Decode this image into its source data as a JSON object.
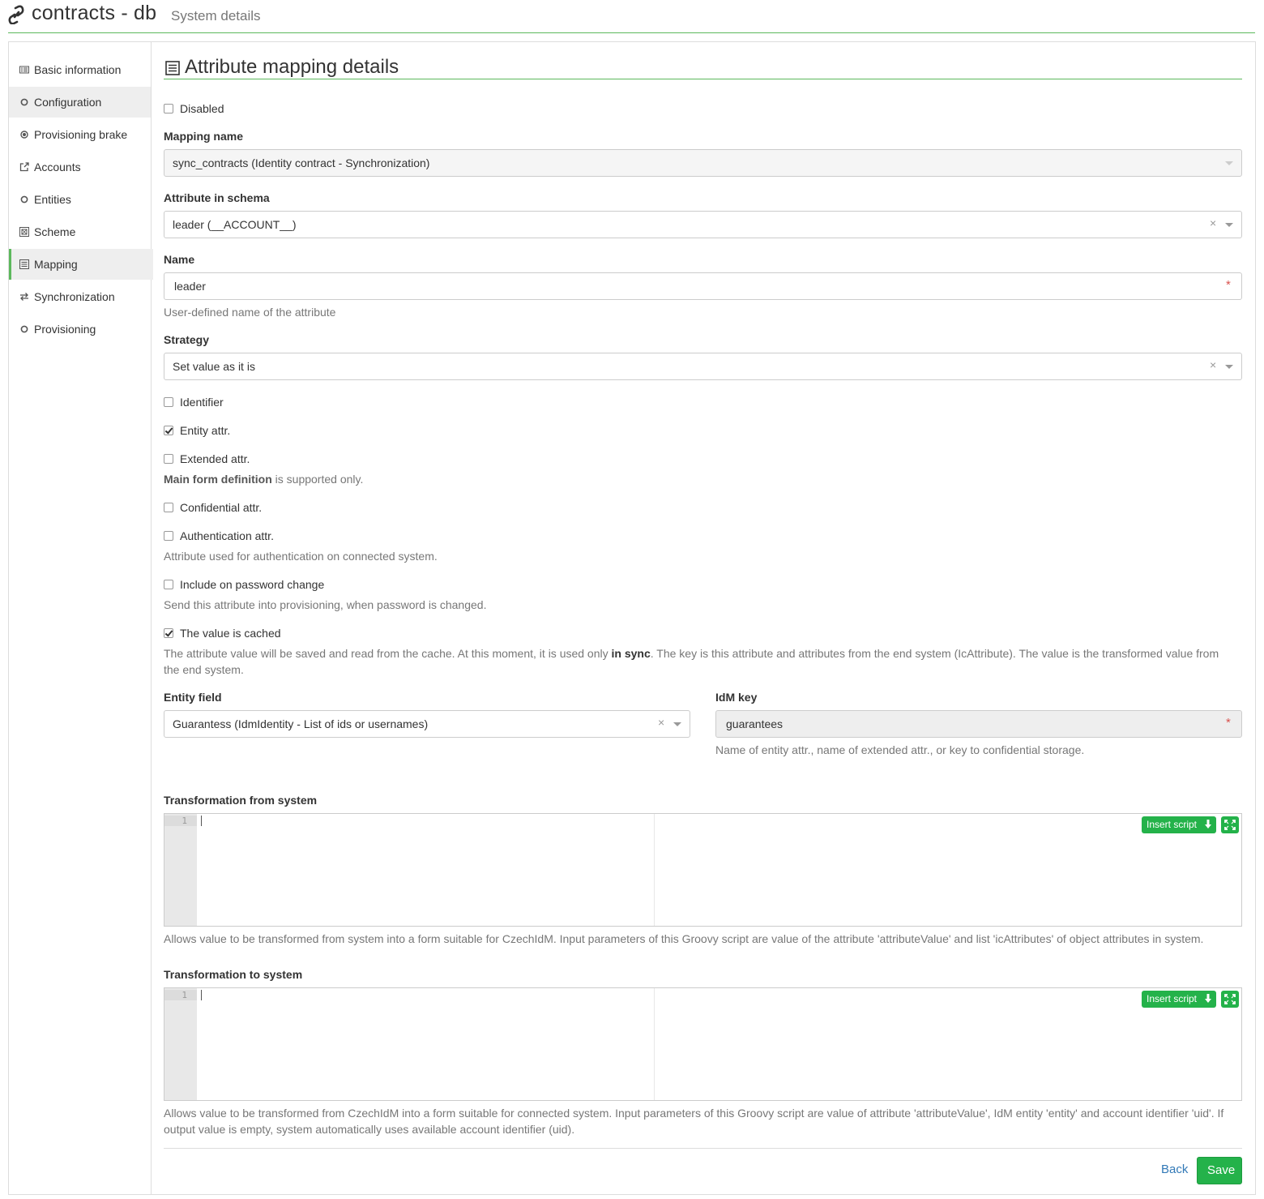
{
  "header": {
    "title": "contracts - db",
    "subtitle": "System details"
  },
  "sidebar": {
    "items": [
      {
        "label": "Basic information",
        "icon": "list-alt-icon"
      },
      {
        "label": "Configuration",
        "icon": "circle-icon"
      },
      {
        "label": "Provisioning brake",
        "icon": "record-icon"
      },
      {
        "label": "Accounts",
        "icon": "external-link-icon"
      },
      {
        "label": "Entities",
        "icon": "circle-icon"
      },
      {
        "label": "Scheme",
        "icon": "object-align-icon"
      },
      {
        "label": "Mapping",
        "icon": "list-icon",
        "active": true
      },
      {
        "label": "Synchronization",
        "icon": "transfer-icon"
      },
      {
        "label": "Provisioning",
        "icon": "circle-icon"
      }
    ]
  },
  "main": {
    "title": "Attribute mapping details",
    "disabled": {
      "label": "Disabled",
      "checked": false
    },
    "mapping_name": {
      "label": "Mapping name",
      "value": "sync_contracts (Identity contract - Synchronization)"
    },
    "attribute_in_schema": {
      "label": "Attribute in schema",
      "value": "leader (__ACCOUNT__)"
    },
    "name": {
      "label": "Name",
      "value": "leader",
      "help": "User-defined name of the attribute"
    },
    "strategy": {
      "label": "Strategy",
      "value": "Set value as it is"
    },
    "identifier": {
      "label": "Identifier",
      "checked": false
    },
    "entity_attr": {
      "label": "Entity attr.",
      "checked": true
    },
    "extended_attr": {
      "label": "Extended attr.",
      "checked": false,
      "help_bold": "Main form definition",
      "help_rest": " is supported only."
    },
    "confidential_attr": {
      "label": "Confidential attr.",
      "checked": false
    },
    "authentication_attr": {
      "label": "Authentication attr.",
      "checked": false,
      "help": "Attribute used for authentication on connected system."
    },
    "password_change": {
      "label": "Include on password change",
      "checked": false,
      "help": "Send this attribute into provisioning, when password is changed."
    },
    "cached": {
      "label": "The value is cached",
      "checked": true,
      "help_part1": "The attribute value will be saved and read from the cache. At this moment, it is used only ",
      "help_bold": "in sync",
      "help_part2": ". The key is this attribute and attributes from the end system (IcAttribute). The value is the transformed value from the end system."
    },
    "entity_field": {
      "label": "Entity field",
      "value": "Guarantess (IdmIdentity - List of ids or usernames)"
    },
    "idm_key": {
      "label": "IdM key",
      "value": "guarantees",
      "help": "Name of entity attr., name of extended attr., or key to confidential storage."
    },
    "transform_from": {
      "label": "Transformation from system",
      "line_number": "1",
      "insert_label": "Insert script",
      "help": "Allows value to be transformed from system into a form suitable for CzechIdM. Input parameters of this Groovy script are value of the attribute 'attributeValue' and list 'icAttributes' of object attributes in system."
    },
    "transform_to": {
      "label": "Transformation to system",
      "line_number": "1",
      "insert_label": "Insert script",
      "help": "Allows value to be transformed from CzechIdM into a form suitable for connected system. Input parameters of this Groovy script are value of attribute 'attributeValue', IdM entity 'entity' and account identifier 'uid'. If output value is empty, system automatically uses available account identifier (uid)."
    }
  },
  "footer": {
    "back_label": "Back",
    "save_label": "Save"
  },
  "colors": {
    "accent": "#5cb85c",
    "button_green": "#24b24a",
    "link": "#337ab7",
    "required": "#d9534f"
  }
}
